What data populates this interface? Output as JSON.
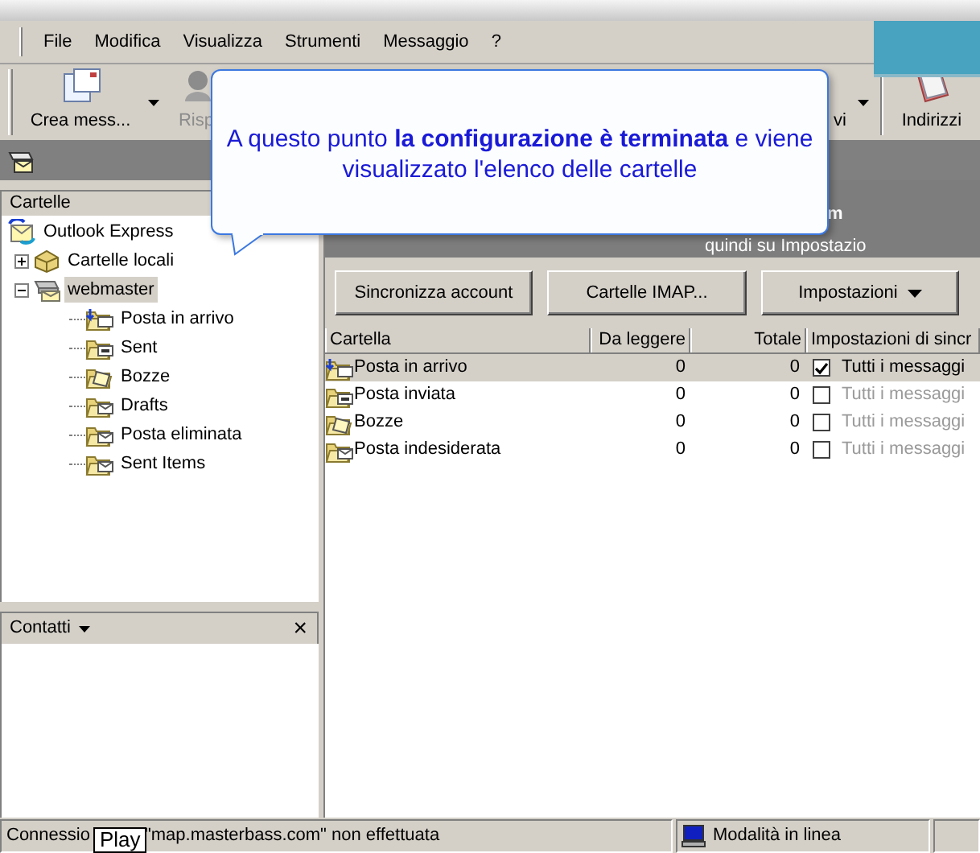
{
  "menu_bar": [
    "File",
    "Modifica",
    "Visualizza",
    "Strumenti",
    "Messaggio",
    "?"
  ],
  "toolbar": [
    {
      "label": "Crea mess...",
      "disabled": false,
      "dropdown": true,
      "kind": "new"
    },
    {
      "label": "Risp",
      "disabled": true,
      "dropdown": false,
      "kind": "reply"
    }
  ],
  "toolbar_right": [
    {
      "label": "vi",
      "disabled": false,
      "dropdown": true,
      "kind": "none"
    },
    {
      "label": "Indirizzi",
      "disabled": false,
      "dropdown": false,
      "kind": "book"
    }
  ],
  "callout": {
    "text": "A questo punto **la configurazione è terminata** e viene visualizzato l'elenco delle cartelle"
  },
  "folder_pane": {
    "title": "Cartelle",
    "tree": [
      {
        "label": "Outlook Express",
        "kind": "oe",
        "selected": false,
        "children": [
          {
            "label": "Cartelle locali",
            "kind": "local",
            "selected": false,
            "expanded": false
          },
          {
            "label": "webmaster",
            "kind": "server",
            "selected": true,
            "expanded": true,
            "children": [
              {
                "label": "Posta in arrivo",
                "kind": "inbox",
                "selected": false
              },
              {
                "label": "Sent",
                "kind": "sent",
                "selected": false
              },
              {
                "label": "Bozze",
                "kind": "drafts",
                "selected": false
              },
              {
                "label": "Drafts",
                "kind": "folder",
                "selected": false
              },
              {
                "label": "Posta eliminata",
                "kind": "folder",
                "selected": false
              },
              {
                "label": "Sent Items",
                "kind": "folder",
                "selected": false
              }
            ]
          }
        ]
      }
    ]
  },
  "contacts_pane": {
    "title": "Contatti",
    "close": "×"
  },
  "account_header": {
    "title": "m",
    "hint": "quindi su Impostazio"
  },
  "buttons": [
    {
      "label": "Sincronizza account",
      "dropdown": false
    },
    {
      "label": "Cartelle IMAP...",
      "dropdown": false
    },
    {
      "label": "Impostazioni",
      "dropdown": true
    }
  ],
  "table": {
    "columns": [
      "Cartella",
      "Da leggere",
      "Totale",
      "Impostazioni di sincr"
    ],
    "rows": [
      {
        "kind": "inbox",
        "name": "Posta in arrivo",
        "unread": "0",
        "total": "0",
        "checked": true,
        "sync": "Tutti i messaggi",
        "selected": true
      },
      {
        "kind": "sent",
        "name": "Posta inviata",
        "unread": "0",
        "total": "0",
        "checked": false,
        "sync": "Tutti i messaggi",
        "selected": false
      },
      {
        "kind": "drafts",
        "name": "Bozze",
        "unread": "0",
        "total": "0",
        "checked": false,
        "sync": "Tutti i messaggi",
        "selected": false
      },
      {
        "kind": "folder",
        "name": "Posta indesiderata",
        "unread": "0",
        "total": "0",
        "checked": false,
        "sync": "Tutti i messaggi",
        "selected": false
      }
    ]
  },
  "status_bar": {
    "message_start": "Connessio",
    "message_end": "\"map.masterbass.com\" non effettuata",
    "mode": "Modalità in linea"
  },
  "tooltip": "Play"
}
